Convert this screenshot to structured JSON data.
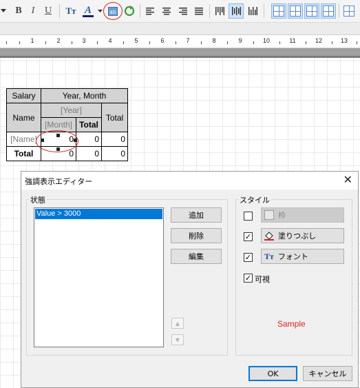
{
  "toolbar": {
    "bold": "B",
    "italic": "I",
    "underline": "U",
    "text_font_icon": "Tт",
    "text_color_icon": "A",
    "highlight_icon": "ab",
    "icons": [
      "bold-icon",
      "italic-icon",
      "underline-icon",
      "font-icon",
      "text-color-icon",
      "highlight-editor-icon",
      "refresh-icon",
      "align-left-icon",
      "align-center-icon",
      "align-right-icon",
      "justify-icon",
      "vertical-align-icons",
      "border-grid-icons"
    ]
  },
  "ruler": {
    "marks": [
      "1",
      "2",
      "3",
      "4",
      "5",
      "6",
      "7",
      "8",
      "9",
      "10",
      "11",
      "12",
      "13"
    ]
  },
  "pivot": {
    "corner": "Salary",
    "col_header": "Year, Month",
    "row_field": "Name",
    "year_field": "[Year]",
    "month_field": "[Month]",
    "total_label": "Total",
    "col_total_label": "Total",
    "data_row_label": "[Name]",
    "total_row_label": "Total",
    "data_values": [
      "0",
      "0",
      "0"
    ],
    "total_values": [
      "0",
      "0",
      "0"
    ]
  },
  "dialog": {
    "title": "強調表示エディター",
    "close_glyph": "✕",
    "conditions_label": "状態",
    "conditions": [
      "Value > 3000"
    ],
    "add_label": "追加",
    "delete_label": "削除",
    "edit_label": "編集",
    "style_label": "スタイル",
    "border_label": "枠",
    "fill_label": "塗りつぶし",
    "font_label": "フォント",
    "visible_label": "可視",
    "border_checked": false,
    "fill_checked": true,
    "font_checked": true,
    "visible_checked": true,
    "sample_text": "Sample",
    "sample_color": "#e02020",
    "ok_label": "OK",
    "cancel_label": "キャンセル"
  },
  "colors": {
    "selection": "#0078d7",
    "header_bg": "#d3d3d3",
    "annotation_red": "#cc2222"
  }
}
